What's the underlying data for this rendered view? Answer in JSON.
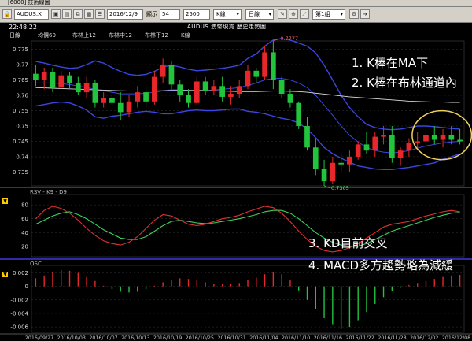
{
  "window": {
    "title": "[6000] 技術線圖"
  },
  "toolbar": {
    "symbol_value": "AUDUS.X",
    "date_value": "2016/12/9",
    "display_label": "顯示",
    "display_value": "54",
    "count_value": "2500",
    "kline_select": "K線",
    "period_select": "日線",
    "group_select": "第1組",
    "icons": [
      "lock-icon",
      "save-icon",
      "print-icon",
      "copy-icon",
      "grid-icon",
      "list-icon",
      "pin-icon",
      "zoom-icon",
      "draw-icon",
      "settings-icon",
      "arrow-icon"
    ]
  },
  "header": {
    "time": "22:48:22",
    "chart_title": "AUDUS 澳幣現貨 歷史走勢圖",
    "period_label": "日線"
  },
  "legend": {
    "items": [
      "均價60",
      "布林上12",
      "布林中12",
      "布林下12",
      "K線"
    ]
  },
  "annotations": [
    "1. K棒在MA下",
    "2. K棒在布林通道內",
    "3. KD目前交叉",
    "4. MACD多方趨勢略為減緩"
  ],
  "colors": {
    "up": "#e8272a",
    "down": "#22c43d",
    "ma60": "#dddddd",
    "bollinger": "#3b46e0",
    "k_line": "#e23030",
    "d_line": "#40d060",
    "highlight_ellipse": "#f0d060",
    "divider": "#3a3adf",
    "axis_text": "#dddddd"
  },
  "chart_data": [
    {
      "type": "candlestick",
      "name": "price",
      "y_ticks": [
        "0.775",
        "0.77",
        "0.765",
        "0.76",
        "0.755",
        "0.75",
        "0.745",
        "0.74",
        "0.735"
      ],
      "ylim": [
        0.7305,
        0.7777
      ],
      "max_label": "0.7777",
      "min_label": "0.7305",
      "candles": [
        {
          "o": 0.767,
          "h": 0.77,
          "l": 0.763,
          "c": 0.765
        },
        {
          "o": 0.765,
          "h": 0.769,
          "l": 0.762,
          "c": 0.7675
        },
        {
          "o": 0.7675,
          "h": 0.769,
          "l": 0.761,
          "c": 0.7625
        },
        {
          "o": 0.7625,
          "h": 0.768,
          "l": 0.762,
          "c": 0.7665
        },
        {
          "o": 0.7665,
          "h": 0.7675,
          "l": 0.762,
          "c": 0.764
        },
        {
          "o": 0.764,
          "h": 0.766,
          "l": 0.76,
          "c": 0.761
        },
        {
          "o": 0.761,
          "h": 0.766,
          "l": 0.759,
          "c": 0.764
        },
        {
          "o": 0.764,
          "h": 0.765,
          "l": 0.756,
          "c": 0.7575
        },
        {
          "o": 0.7575,
          "h": 0.761,
          "l": 0.756,
          "c": 0.759
        },
        {
          "o": 0.759,
          "h": 0.762,
          "l": 0.757,
          "c": 0.7575
        },
        {
          "o": 0.7575,
          "h": 0.761,
          "l": 0.752,
          "c": 0.7545
        },
        {
          "o": 0.7545,
          "h": 0.76,
          "l": 0.753,
          "c": 0.758
        },
        {
          "o": 0.758,
          "h": 0.763,
          "l": 0.756,
          "c": 0.761
        },
        {
          "o": 0.761,
          "h": 0.763,
          "l": 0.756,
          "c": 0.758
        },
        {
          "o": 0.758,
          "h": 0.768,
          "l": 0.757,
          "c": 0.766
        },
        {
          "o": 0.766,
          "h": 0.772,
          "l": 0.764,
          "c": 0.77
        },
        {
          "o": 0.77,
          "h": 0.771,
          "l": 0.762,
          "c": 0.7635
        },
        {
          "o": 0.7635,
          "h": 0.765,
          "l": 0.758,
          "c": 0.76
        },
        {
          "o": 0.76,
          "h": 0.762,
          "l": 0.756,
          "c": 0.7575
        },
        {
          "o": 0.7575,
          "h": 0.766,
          "l": 0.757,
          "c": 0.7645
        },
        {
          "o": 0.7645,
          "h": 0.766,
          "l": 0.76,
          "c": 0.7615
        },
        {
          "o": 0.7615,
          "h": 0.765,
          "l": 0.76,
          "c": 0.763
        },
        {
          "o": 0.763,
          "h": 0.766,
          "l": 0.758,
          "c": 0.7595
        },
        {
          "o": 0.7595,
          "h": 0.763,
          "l": 0.757,
          "c": 0.7605
        },
        {
          "o": 0.7605,
          "h": 0.765,
          "l": 0.759,
          "c": 0.763
        },
        {
          "o": 0.763,
          "h": 0.77,
          "l": 0.762,
          "c": 0.768
        },
        {
          "o": 0.768,
          "h": 0.769,
          "l": 0.764,
          "c": 0.766
        },
        {
          "o": 0.766,
          "h": 0.776,
          "l": 0.765,
          "c": 0.774
        },
        {
          "o": 0.774,
          "h": 0.7777,
          "l": 0.762,
          "c": 0.765
        },
        {
          "o": 0.765,
          "h": 0.766,
          "l": 0.759,
          "c": 0.7605
        },
        {
          "o": 0.7605,
          "h": 0.762,
          "l": 0.756,
          "c": 0.7575
        },
        {
          "o": 0.7575,
          "h": 0.758,
          "l": 0.749,
          "c": 0.75
        },
        {
          "o": 0.75,
          "h": 0.753,
          "l": 0.742,
          "c": 0.743
        },
        {
          "o": 0.743,
          "h": 0.746,
          "l": 0.734,
          "c": 0.736
        },
        {
          "o": 0.736,
          "h": 0.739,
          "l": 0.7305,
          "c": 0.732
        },
        {
          "o": 0.732,
          "h": 0.74,
          "l": 0.731,
          "c": 0.738
        },
        {
          "o": 0.738,
          "h": 0.741,
          "l": 0.735,
          "c": 0.7375
        },
        {
          "o": 0.7375,
          "h": 0.742,
          "l": 0.735,
          "c": 0.74
        },
        {
          "o": 0.74,
          "h": 0.745,
          "l": 0.739,
          "c": 0.744
        },
        {
          "o": 0.744,
          "h": 0.748,
          "l": 0.741,
          "c": 0.742
        },
        {
          "o": 0.742,
          "h": 0.748,
          "l": 0.74,
          "c": 0.7465
        },
        {
          "o": 0.7465,
          "h": 0.75,
          "l": 0.744,
          "c": 0.747
        },
        {
          "o": 0.747,
          "h": 0.75,
          "l": 0.738,
          "c": 0.7395
        },
        {
          "o": 0.7395,
          "h": 0.743,
          "l": 0.737,
          "c": 0.742
        },
        {
          "o": 0.742,
          "h": 0.746,
          "l": 0.74,
          "c": 0.7445
        },
        {
          "o": 0.7445,
          "h": 0.748,
          "l": 0.742,
          "c": 0.745
        },
        {
          "o": 0.745,
          "h": 0.749,
          "l": 0.743,
          "c": 0.747
        },
        {
          "o": 0.747,
          "h": 0.75,
          "l": 0.744,
          "c": 0.7455
        },
        {
          "o": 0.7455,
          "h": 0.749,
          "l": 0.743,
          "c": 0.747
        },
        {
          "o": 0.747,
          "h": 0.75,
          "l": 0.744,
          "c": 0.7455
        },
        {
          "o": 0.7455,
          "h": 0.749,
          "l": 0.744,
          "c": 0.745
        }
      ],
      "ma60": [
        0.7625,
        0.7624,
        0.7623,
        0.7622,
        0.7621,
        0.762,
        0.7619,
        0.7618,
        0.7617,
        0.7616,
        0.7615,
        0.7614,
        0.7614,
        0.7614,
        0.7614,
        0.7615,
        0.7616,
        0.7616,
        0.7616,
        0.7616,
        0.7616,
        0.7615,
        0.7614,
        0.7613,
        0.7612,
        0.7612,
        0.7612,
        0.7613,
        0.7614,
        0.7614,
        0.7613,
        0.7612,
        0.761,
        0.7607,
        0.7604,
        0.7601,
        0.7598,
        0.7595,
        0.7593,
        0.7591,
        0.7589,
        0.7587,
        0.7585,
        0.7583,
        0.7581,
        0.758,
        0.7579,
        0.7578,
        0.7578,
        0.7577,
        0.7577
      ],
      "boll_upper": [
        0.771,
        0.7705,
        0.7698,
        0.7692,
        0.7688,
        0.769,
        0.77,
        0.7712,
        0.7705,
        0.769,
        0.7678,
        0.7668,
        0.7665,
        0.7668,
        0.7678,
        0.7692,
        0.7698,
        0.7692,
        0.7685,
        0.768,
        0.7682,
        0.7685,
        0.7688,
        0.7692,
        0.7698,
        0.772,
        0.7735,
        0.776,
        0.778,
        0.7785,
        0.778,
        0.777,
        0.776,
        0.7738,
        0.7698,
        0.765,
        0.76,
        0.756,
        0.753,
        0.7505,
        0.7495,
        0.749,
        0.7488,
        0.749,
        0.7495,
        0.75,
        0.75,
        0.7498,
        0.7495,
        0.7492,
        0.749
      ],
      "boll_mid": [
        0.764,
        0.764,
        0.764,
        0.7638,
        0.7635,
        0.763,
        0.7625,
        0.762,
        0.7615,
        0.761,
        0.7605,
        0.7605,
        0.7605,
        0.7607,
        0.761,
        0.7615,
        0.7618,
        0.7618,
        0.7616,
        0.7615,
        0.7615,
        0.7617,
        0.762,
        0.7622,
        0.7625,
        0.7632,
        0.764,
        0.765,
        0.7655,
        0.7655,
        0.765,
        0.764,
        0.7625,
        0.76,
        0.7568,
        0.7535,
        0.75,
        0.747,
        0.7448,
        0.743,
        0.742,
        0.7415,
        0.7412,
        0.7415,
        0.742,
        0.7428,
        0.7435,
        0.744,
        0.7445,
        0.7448,
        0.745
      ],
      "boll_lower": [
        0.7565,
        0.757,
        0.7575,
        0.7578,
        0.7575,
        0.7565,
        0.7552,
        0.753,
        0.7525,
        0.7532,
        0.7535,
        0.754,
        0.7545,
        0.7548,
        0.7545,
        0.754,
        0.754,
        0.7545,
        0.755,
        0.7552,
        0.755,
        0.755,
        0.7552,
        0.7555,
        0.7555,
        0.7548,
        0.7545,
        0.754,
        0.7532,
        0.7525,
        0.752,
        0.751,
        0.749,
        0.7462,
        0.743,
        0.741,
        0.7395,
        0.7382,
        0.737,
        0.7365,
        0.736,
        0.7358,
        0.7358,
        0.7362,
        0.7365,
        0.737,
        0.7375,
        0.738,
        0.7392,
        0.74,
        0.741
      ]
    },
    {
      "type": "line",
      "name": "kd",
      "title": "RSV - K9 - D9",
      "y_ticks": [
        "80",
        "60",
        "40",
        "20"
      ],
      "ylim": [
        5,
        95
      ],
      "series": [
        {
          "name": "K9",
          "values": [
            60,
            72,
            78,
            75,
            68,
            58,
            46,
            36,
            28,
            24,
            22,
            26,
            34,
            46,
            58,
            66,
            64,
            58,
            52,
            50,
            52,
            56,
            60,
            62,
            65,
            70,
            74,
            78,
            76,
            68,
            56,
            42,
            30,
            20,
            14,
            12,
            14,
            18,
            24,
            32,
            40,
            48,
            52,
            54,
            56,
            60,
            64,
            67,
            70,
            72,
            70
          ]
        },
        {
          "name": "D9",
          "values": [
            52,
            58,
            64,
            68,
            70,
            66,
            60,
            52,
            44,
            38,
            32,
            30,
            30,
            34,
            42,
            50,
            56,
            58,
            56,
            54,
            53,
            54,
            56,
            58,
            60,
            63,
            66,
            70,
            72,
            72,
            68,
            60,
            50,
            40,
            32,
            26,
            22,
            20,
            20,
            24,
            30,
            36,
            42,
            46,
            50,
            54,
            58,
            62,
            65,
            68,
            69
          ]
        }
      ]
    },
    {
      "type": "bar",
      "name": "osc",
      "title": "OSC",
      "y_ticks": [
        "0.002",
        "0",
        "-0.002",
        "-0.004",
        "-0.006"
      ],
      "ylim": [
        -0.0068,
        0.0031
      ],
      "values": [
        0.0012,
        0.0016,
        0.0021,
        0.0024,
        0.0023,
        0.002,
        0.0014,
        0.0008,
        0.0001,
        -0.0004,
        -0.0008,
        -0.0009,
        -0.0008,
        -0.0004,
        0.0001,
        0.0006,
        0.001,
        0.0012,
        0.0011,
        0.0009,
        0.0006,
        0.0004,
        0.0003,
        0.0004,
        0.0005,
        0.0009,
        0.0013,
        0.0018,
        0.0021,
        0.0018,
        0.0009,
        -0.0006,
        -0.002,
        -0.0034,
        -0.0047,
        -0.0057,
        -0.0063,
        -0.006,
        -0.005,
        -0.0038,
        -0.0026,
        -0.0016,
        -0.0007,
        -0.0002,
        0.0002,
        0.0005,
        0.0008,
        0.0011,
        0.0014,
        0.0016,
        0.0017
      ]
    }
  ],
  "x_axis": {
    "dates": [
      "2016/09/27",
      "2016/10/03",
      "2016/10/07",
      "2016/10/13",
      "2016/10/19",
      "2016/10/25",
      "2016/10/31",
      "2016/11/04",
      "2016/11/10",
      "2016/11/16",
      "2016/11/22",
      "2016/11/28",
      "2016/12/02",
      "2016/12/08"
    ]
  }
}
